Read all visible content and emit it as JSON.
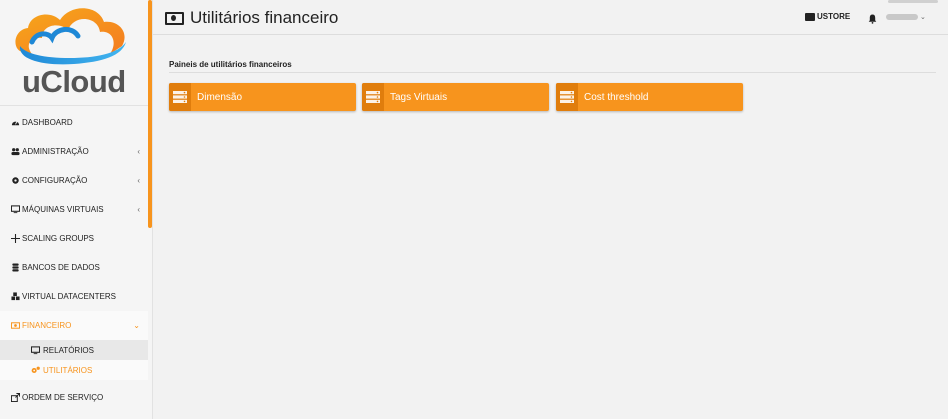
{
  "brand": {
    "name": "uCloud",
    "accent": "#f7941d",
    "accent_dark": "#e07d0c"
  },
  "header": {
    "title": "Utilitários financeiro",
    "title_icon": "money-bill-icon",
    "store_label": "USTORE",
    "store_icon": "ustore-icon",
    "bell_icon": "bell-icon",
    "user_caret_icon": "chevron-down-icon"
  },
  "sidebar": {
    "items": [
      {
        "label": "DASHBOARD",
        "icon": "dashboard-icon"
      },
      {
        "label": "ADMINISTRAÇÃO",
        "icon": "users-icon",
        "caret": "‹"
      },
      {
        "label": "CONFIGURAÇÃO",
        "icon": "cog-icon",
        "caret": "‹"
      },
      {
        "label": "MÁQUINAS VIRTUAIS",
        "icon": "desktop-icon",
        "caret": "‹"
      },
      {
        "label": "SCALING GROUPS",
        "icon": "arrows-icon"
      },
      {
        "label": "BANCOS DE DADOS",
        "icon": "database-icon"
      },
      {
        "label": "VIRTUAL DATACENTERS",
        "icon": "cubes-icon"
      },
      {
        "label": "FINANCEIRO",
        "icon": "money-icon",
        "caret": "⌄"
      },
      {
        "label": "ORDEM DE SERVIÇO",
        "icon": "external-link-icon"
      }
    ],
    "subitems": [
      {
        "label": "RELATÓRIOS",
        "icon": "desktop-icon"
      },
      {
        "label": "UTILITÁRIOS",
        "icon": "cogs-icon"
      }
    ]
  },
  "main": {
    "section_title": "Paineis de utilitários financeiros",
    "cards": [
      {
        "label": "Dimensão",
        "icon": "server-icon"
      },
      {
        "label": "Tags Virtuais",
        "icon": "server-icon"
      },
      {
        "label": "Cost threshold",
        "icon": "server-icon"
      }
    ]
  }
}
